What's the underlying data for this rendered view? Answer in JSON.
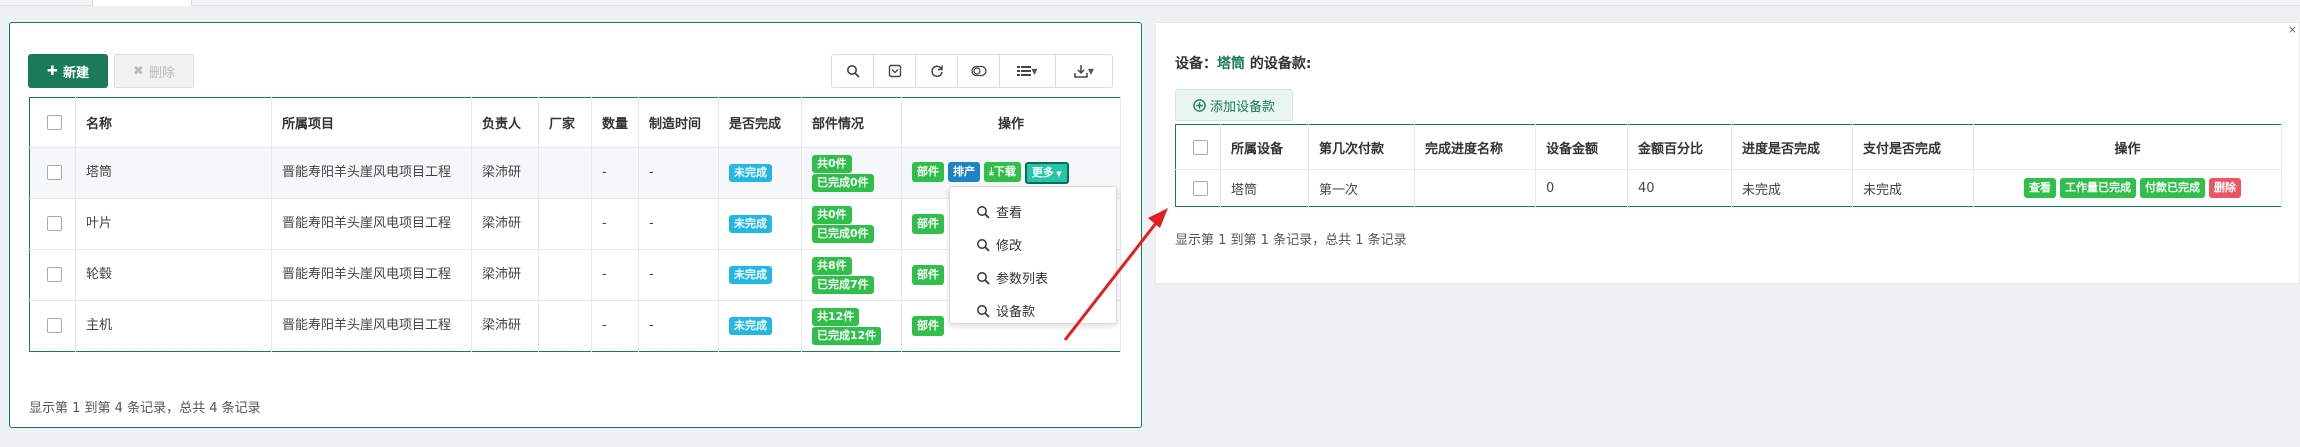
{
  "left": {
    "new_label": "新建",
    "delete_label": "删除",
    "toolbar": {
      "icons": [
        "search-icon",
        "toggle-filter-icon",
        "refresh-icon",
        "toggle-view-icon",
        "columns-icon",
        "export-icon"
      ]
    },
    "columns": [
      "名称",
      "所属项目",
      "负责人",
      "厂家",
      "数量",
      "制造时间",
      "是否完成",
      "部件情况",
      "操作"
    ],
    "rows": [
      {
        "name": "塔筒",
        "project": "晋能寿阳羊头崖风电项目工程",
        "owner": "梁沛研",
        "maker": "",
        "qty": "-",
        "date": "-",
        "done": "未完成",
        "total": "共0件",
        "finished": "已完成0件"
      },
      {
        "name": "叶片",
        "project": "晋能寿阳羊头崖风电项目工程",
        "owner": "梁沛研",
        "maker": "",
        "qty": "-",
        "date": "-",
        "done": "未完成",
        "total": "共0件",
        "finished": "已完成0件"
      },
      {
        "name": "轮毂",
        "project": "晋能寿阳羊头崖风电项目工程",
        "owner": "梁沛研",
        "maker": "",
        "qty": "-",
        "date": "-",
        "done": "未完成",
        "total": "共8件",
        "finished": "已完成7件"
      },
      {
        "name": "主机",
        "project": "晋能寿阳羊头崖风电项目工程",
        "owner": "梁沛研",
        "maker": "",
        "qty": "-",
        "date": "-",
        "done": "未完成",
        "total": "共12件",
        "finished": "已完成12件"
      }
    ],
    "ops": {
      "parts": "部件",
      "schedule": "排产",
      "download": "下载",
      "more": "更多"
    },
    "dropdown": [
      "查看",
      "修改",
      "参数列表",
      "设备款"
    ],
    "footer": "显示第 1 到第 4 条记录，总共 4 条记录"
  },
  "right": {
    "title_prefix": "设备：",
    "device": "塔筒",
    "title_suffix": " 的设备款:",
    "close": "×",
    "add_label": "添加设备款",
    "columns": [
      "所属设备",
      "第几次付款",
      "完成进度名称",
      "设备金额",
      "金额百分比",
      "进度是否完成",
      "支付是否完成",
      "操作"
    ],
    "rows": [
      {
        "device": "塔筒",
        "nth": "第一次",
        "progress": "",
        "amount": "0",
        "percent": "40",
        "progress_done": "未完成",
        "pay_done": "未完成"
      }
    ],
    "ops": {
      "view": "查看",
      "work_done": "工作量已完成",
      "paid": "付款已完成",
      "delete": "删除"
    },
    "footer": "显示第 1 到第 1 条记录，总共 1 条记录"
  },
  "colors": {
    "primary": "#1a7a5a",
    "badge_blue": "#23b7e5",
    "badge_green": "#2fbf4a",
    "danger": "#ed5565",
    "arrow": "#e02020"
  }
}
